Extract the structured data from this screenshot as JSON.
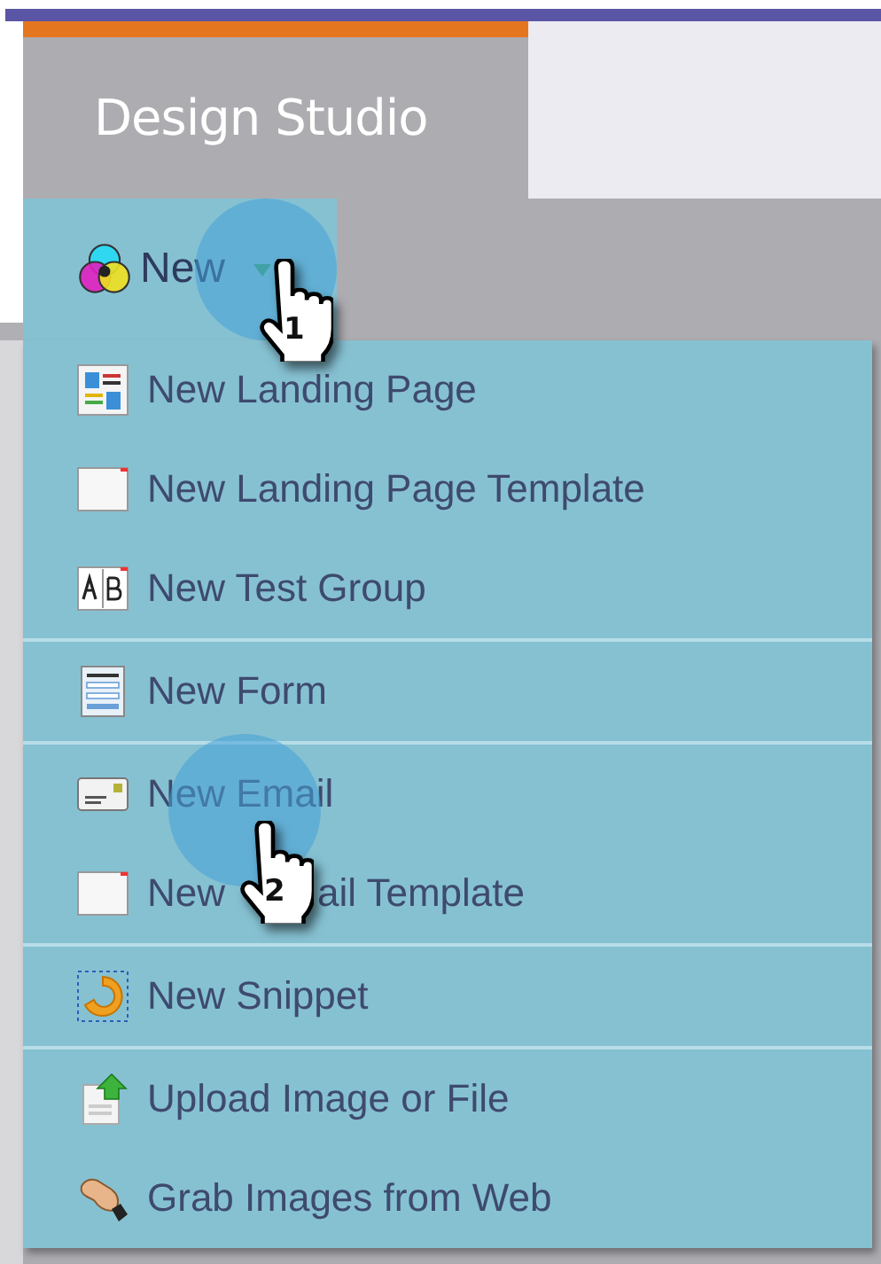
{
  "app": {
    "tab_title": "Design Studio"
  },
  "new_button": {
    "label": "New",
    "expanded": true
  },
  "menu_groups": [
    {
      "items": [
        {
          "kind": "landing-page",
          "label": "New Landing Page"
        },
        {
          "kind": "template",
          "label": "New Landing Page Template"
        },
        {
          "kind": "test-group",
          "label": "New Test Group"
        }
      ]
    },
    {
      "items": [
        {
          "kind": "form",
          "label": "New Form"
        }
      ]
    },
    {
      "items": [
        {
          "kind": "email",
          "label": "New Email"
        },
        {
          "kind": "template",
          "label_parts": [
            "New",
            "ail Template"
          ]
        }
      ]
    },
    {
      "items": [
        {
          "kind": "snippet",
          "label": "New Snippet"
        }
      ]
    },
    {
      "items": [
        {
          "kind": "upload",
          "label": "Upload Image or File"
        },
        {
          "kind": "grab",
          "label": "Grab Images from Web"
        }
      ]
    }
  ],
  "step_callouts": [
    {
      "number": "1"
    },
    {
      "number": "2"
    }
  ]
}
